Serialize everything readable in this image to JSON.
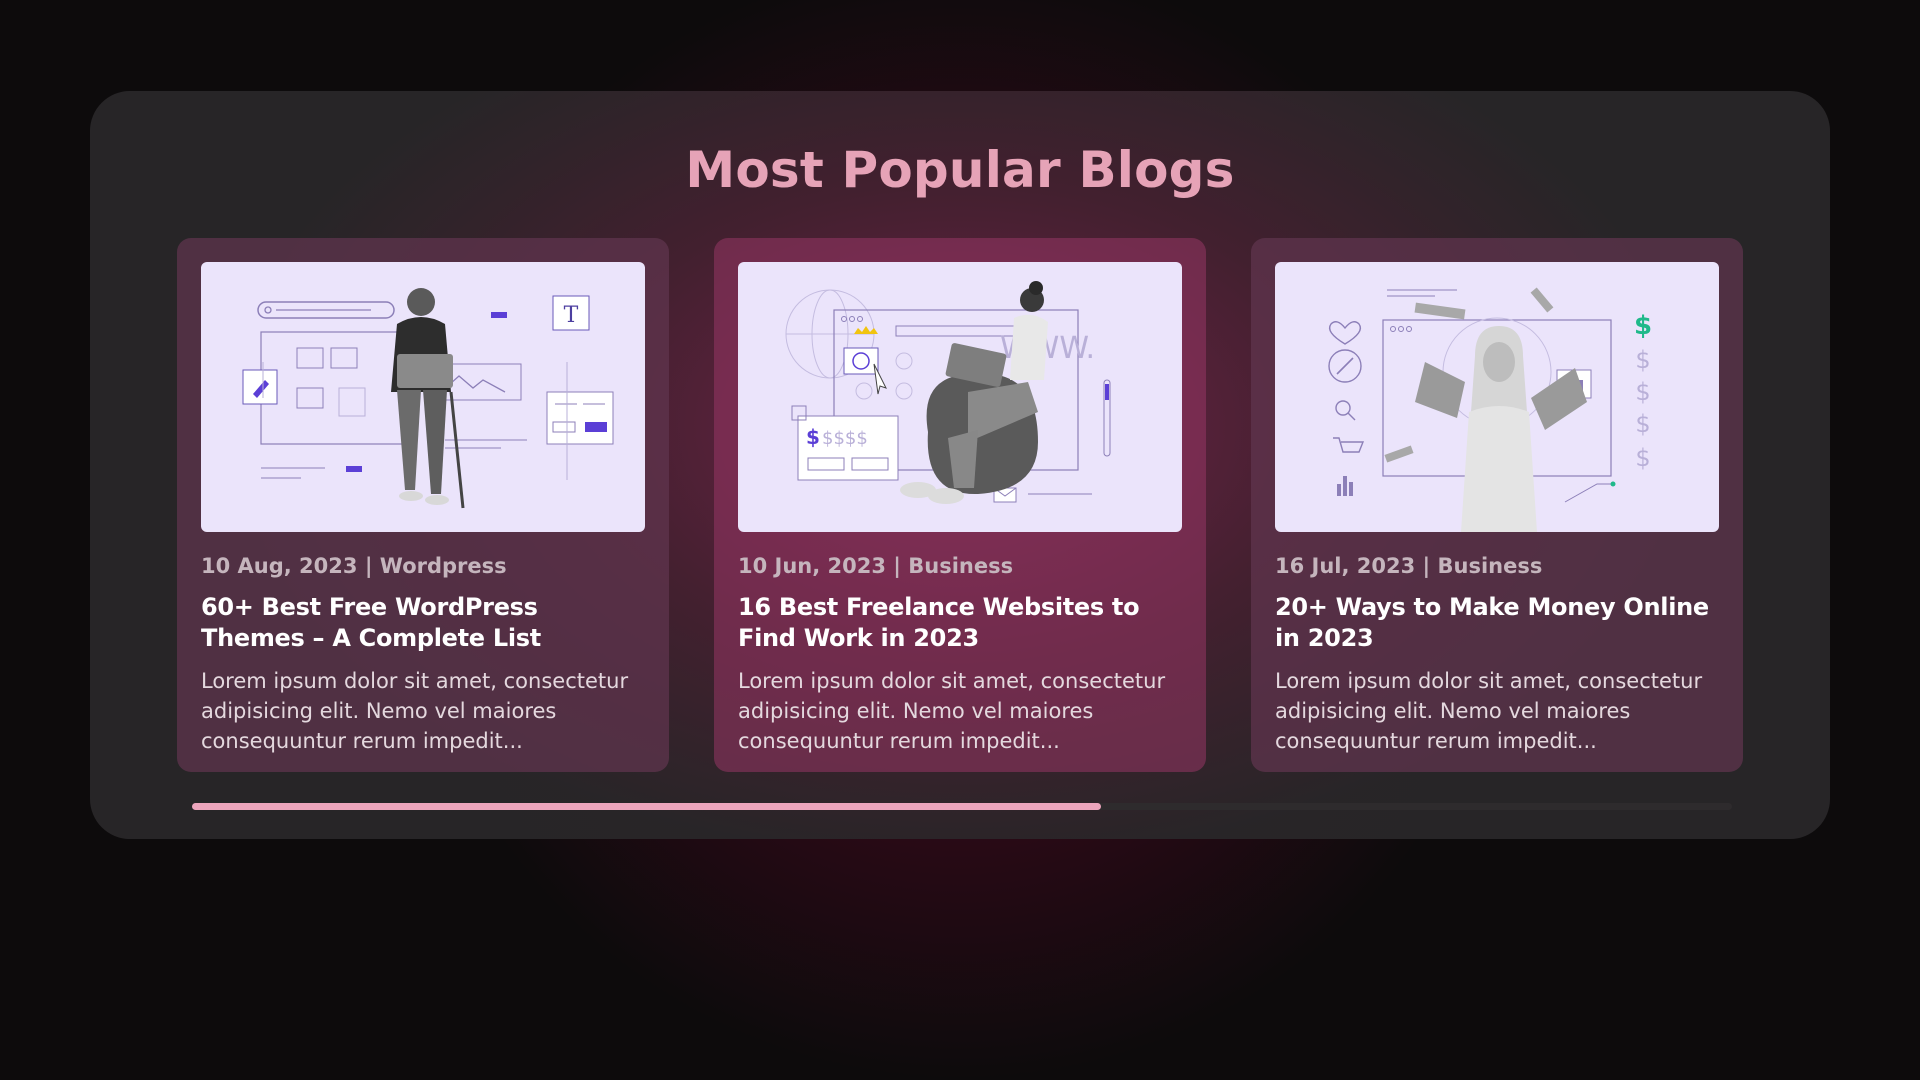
{
  "section": {
    "title": "Most Popular Blogs"
  },
  "cards": [
    {
      "date": "10 Aug, 2023",
      "category": "Wordpress",
      "meta": "10 Aug, 2023 | Wordpress",
      "title": "60+ Best Free WordPress Themes – A Complete List",
      "excerpt": "Lorem ipsum dolor sit amet, consectetur adipisicing elit. Nemo vel maiores consequuntur rerum impedit...",
      "image_icon": "designer-with-laptop-illustration"
    },
    {
      "date": "10 Jun, 2023",
      "category": "Business",
      "meta": "10 Jun, 2023 | Business",
      "title": "16 Best Freelance Websites to Find Work in 2023",
      "excerpt": "Lorem ipsum dolor sit amet, consectetur adipisicing elit. Nemo vel maiores consequuntur rerum impedit...",
      "image_icon": "freelancer-on-beanbag-illustration"
    },
    {
      "date": "16 Jul, 2023",
      "category": "Business",
      "meta": "16 Jul, 2023 | Business",
      "title": "20+ Ways to Make Money Online in 2023",
      "excerpt": "Lorem ipsum dolor sit amet, consectetur adipisicing elit. Nemo vel maiores consequuntur rerum impedit...",
      "image_icon": "woman-holding-money-illustration"
    }
  ],
  "scroll_progress": 0.59,
  "colors": {
    "accent": "#eca5bc",
    "title": "#e6a3b7",
    "illustration_bg": "#ebe4fb",
    "illustration_accent": "#5b3fd6"
  }
}
